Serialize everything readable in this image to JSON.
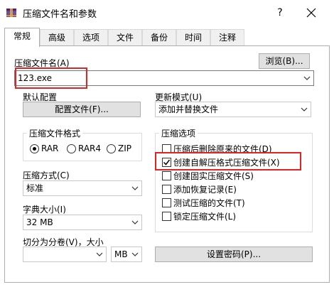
{
  "window": {
    "title": "压缩文件名和参数",
    "help": "?",
    "close": "✕"
  },
  "tabs": [
    {
      "label": "常规",
      "active": true
    },
    {
      "label": "高级"
    },
    {
      "label": "选项"
    },
    {
      "label": "文件"
    },
    {
      "label": "备份"
    },
    {
      "label": "时间"
    },
    {
      "label": "注释"
    }
  ],
  "archive": {
    "label": "压缩文件名(A)",
    "browse": "浏览(B)...",
    "value": "123.exe"
  },
  "profile": {
    "label": "默认配置",
    "button": "配置文件(F)..."
  },
  "update": {
    "label": "更新模式(U)",
    "value": "添加并替换文件"
  },
  "format": {
    "title": "压缩文件格式",
    "options": [
      "RAR",
      "RAR4",
      "ZIP"
    ],
    "selected": "RAR"
  },
  "method": {
    "label": "压缩方式(C)",
    "value": "标准"
  },
  "dict": {
    "label": "字典大小(I)",
    "value": "32 MB"
  },
  "split": {
    "label": "切分为分卷(V)，大小",
    "value": "",
    "unit": "MB"
  },
  "options": {
    "title": "压缩选项",
    "items": [
      {
        "label": "压缩后删除原来的文件(D)",
        "checked": false
      },
      {
        "label": "创建自解压格式压缩文件(X)",
        "checked": true
      },
      {
        "label": "创建固实压缩文件(S)",
        "checked": false
      },
      {
        "label": "添加恢复记录(E)",
        "checked": false
      },
      {
        "label": "测试压缩的文件(T)",
        "checked": false
      },
      {
        "label": "锁定压缩文件(L)",
        "checked": false
      }
    ]
  },
  "password_button": "设置密码(P)...",
  "colors": {
    "highlight": "#e02424",
    "tab_active_bg": "#ffffff",
    "button_bg": "#e1e1e1"
  }
}
